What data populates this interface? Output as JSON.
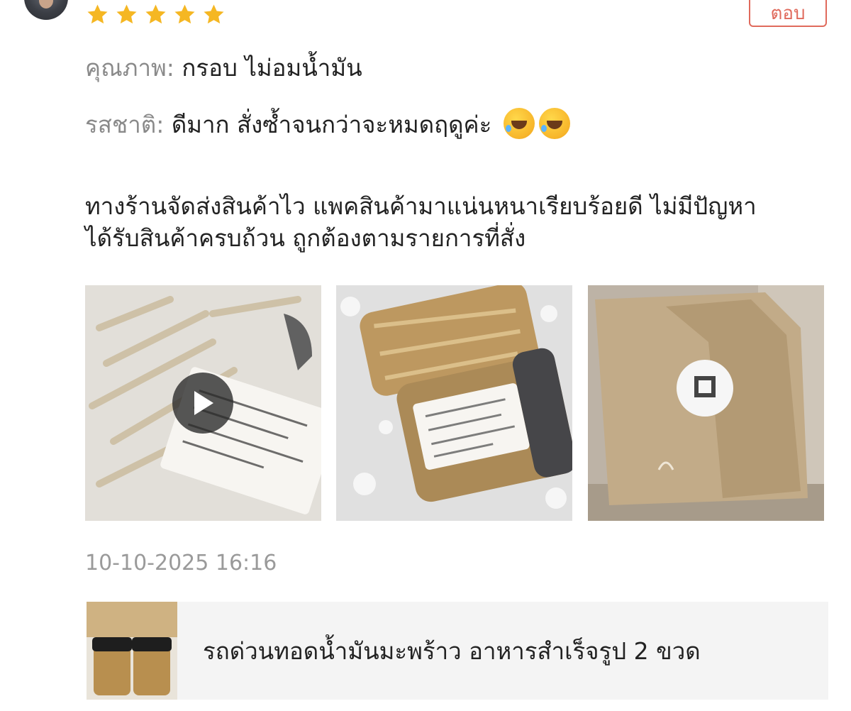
{
  "review": {
    "rating": 5,
    "reply_label": "ตอบ",
    "attributes": [
      {
        "key": "คุณภาพ:",
        "value": "กรอบ ไม่อมน้ำมัน"
      },
      {
        "key": "รสชาติ:",
        "value": "ดีมาก สั่งซ้ำจนกว่าจะหมดฤดูค่ะ"
      }
    ],
    "comment_lines": [
      "ทางร้านจัดส่งสินค้าไว แพคสินค้ามาแน่นหนาเรียบร้อยดี ไม่มีปัญหา",
      "ได้รับสินค้าครบถ้วน ถูกต้องตามรายการที่สั่ง"
    ],
    "timestamp": "10-10-2025 16:16"
  },
  "product": {
    "title": "รถด่วนทอดน้ำมันมะพร้าว อาหารสำเร็จรูป 2 ขวด"
  },
  "colors": {
    "star": "#f5b723",
    "accent": "#e06a5c"
  },
  "icons": [
    "star-icon",
    "play-icon",
    "emoji-rofl-icon"
  ]
}
